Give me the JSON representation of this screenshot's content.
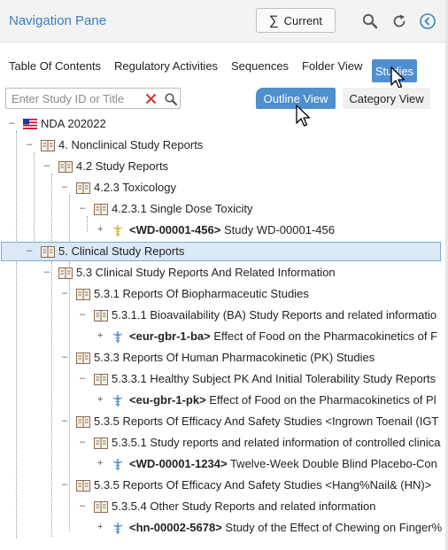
{
  "header": {
    "title": "Navigation Pane",
    "current_label": "Current",
    "current_symbol": "∑"
  },
  "tabs": [
    {
      "label": "Table Of Contents"
    },
    {
      "label": "Regulatory Activities"
    },
    {
      "label": "Sequences"
    },
    {
      "label": "Folder View"
    },
    {
      "label": "Studies",
      "active": true
    }
  ],
  "search": {
    "placeholder": "Enter Study ID or Title",
    "value": ""
  },
  "views": {
    "outline": "Outline View",
    "category": "Category View",
    "selected": "Outline View"
  },
  "colors": {
    "accent": "#4f8fce",
    "title": "#3b7fc1",
    "selection": "#dbe9f7",
    "clear": "#d9322b"
  },
  "tree": {
    "root": "NDA 202022",
    "n4": "4. Nonclinical Study Reports",
    "n42": "4.2 Study Reports",
    "n423": "4.2.3 Toxicology",
    "n4231": "4.2.3.1 Single Dose Toxicity",
    "s1_id": "<WD-00001-456>",
    "s1_title": " Study WD-00001-456",
    "n5": "5. Clinical Study Reports",
    "n53": "5.3 Clinical Study Reports And Related Information",
    "n531": "5.3.1 Reports Of Biopharmaceutic Studies",
    "n5311": "5.3.1.1 Bioavailability (BA) Study Reports and related informatio",
    "s2_id": "<eur-gbr-1-ba>",
    "s2_title": " Effect of Food on the Pharmacokinetics of F",
    "n533": "5.3.3 Reports Of Human Pharmacokinetic (PK) Studies",
    "n5331": "5.3.3.1 Healthy Subject PK And Initial Tolerability Study Reports",
    "s3_id": "<eu-gbr-1-pk>",
    "s3_title": " Effect of Food on the Pharmacokinetics of Pl",
    "n535a": "5.3.5 Reports Of Efficacy And Safety Studies <Ingrown Toenail (IGT",
    "n5351": "5.3.5.1 Study reports and related information of controlled clinica",
    "s4_id": "<WD-00001-1234>",
    "s4_title": " Twelve-Week Double Blind Placebo-Con",
    "n535b": "5.3.5 Reports Of Efficacy And Safety Studies <Hang%Nail& (HN)>",
    "n5354": "5.3.5.4 Other Study Reports and related information",
    "s5_id": "<hn-00002-5678>",
    "s5_title": " Study of the Effect of Chewing on Finger%"
  }
}
